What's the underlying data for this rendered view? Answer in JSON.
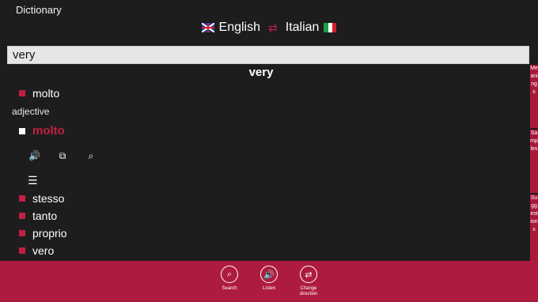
{
  "app": {
    "title": "Dictionary"
  },
  "languages": {
    "source": "English",
    "target": "Italian",
    "swap_icon": "swap-arrows-icon"
  },
  "search": {
    "value": "very"
  },
  "headword": "very",
  "top_translation": "molto",
  "part_of_speech": "adjective",
  "main_translation": "molto",
  "actions": [
    {
      "name": "speaker-icon",
      "glyph": "🔊"
    },
    {
      "name": "copy-icon",
      "glyph": "⧉"
    },
    {
      "name": "magnifier-icon",
      "glyph": "⌕"
    }
  ],
  "synonyms": [
    "stesso",
    "tanto",
    "proprio",
    "vero"
  ],
  "side_tabs": [
    "Meanings",
    "Samples",
    "Suggestions"
  ],
  "appbar": {
    "search_label": "Search",
    "listen_label": "Listen",
    "change_direction_label": "Change direction"
  },
  "colors": {
    "accent": "#c21f44",
    "appbar": "#ad1b3f",
    "background": "#1d1d1d"
  }
}
